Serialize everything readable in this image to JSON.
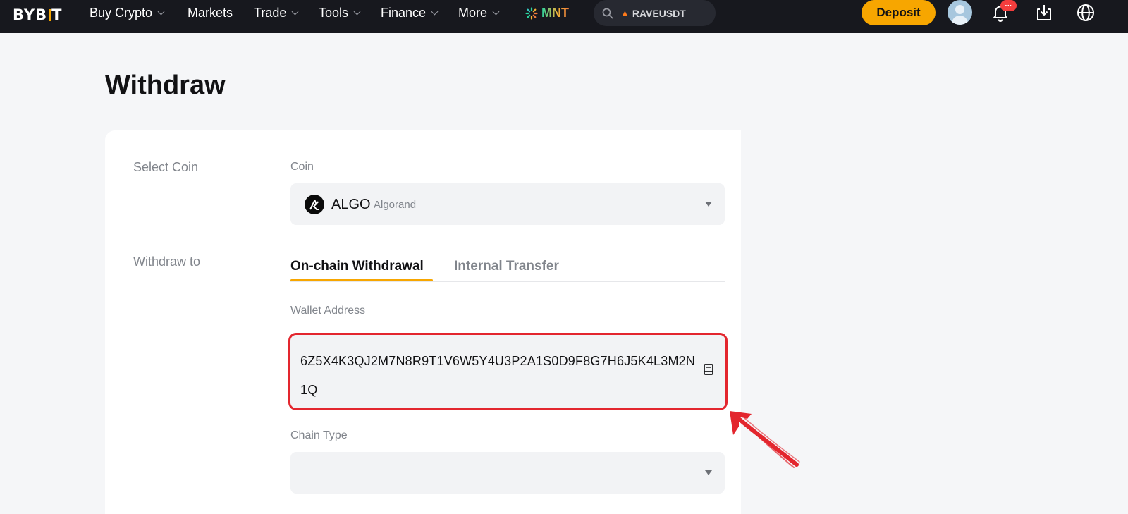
{
  "brand": {
    "logo_left": "BYB",
    "logo_right": "T"
  },
  "nav": {
    "items": [
      {
        "label": "Buy Crypto",
        "has_dropdown": true
      },
      {
        "label": "Markets",
        "has_dropdown": false
      },
      {
        "label": "Trade",
        "has_dropdown": true
      },
      {
        "label": "Tools",
        "has_dropdown": true
      },
      {
        "label": "Finance",
        "has_dropdown": true
      },
      {
        "label": "More",
        "has_dropdown": true
      }
    ],
    "promo": "MNT",
    "search": {
      "icon": "search-icon",
      "trending_icon": "flame-icon",
      "value": "RAVEUSDT"
    },
    "deposit_label": "Deposit",
    "notifications_badge": "···",
    "icons": [
      "avatar",
      "bell-icon",
      "download-icon",
      "globe-icon"
    ]
  },
  "page": {
    "title": "Withdraw",
    "select_coin": {
      "row_label": "Select Coin",
      "field_label": "Coin",
      "coin_symbol": "ALGO",
      "coin_name": "Algorand"
    },
    "withdraw_to": {
      "row_label": "Withdraw to",
      "tabs": [
        {
          "label": "On-chain Withdrawal",
          "active": true
        },
        {
          "label": "Internal Transfer",
          "active": false
        }
      ],
      "wallet_address_label": "Wallet Address",
      "wallet_address_value": "6Z5X4K3QJ2M7N8R9T1V6W5Y4U3P2A1S0D9F8G7H6J5K4L3M2N1Q",
      "chain_type_label": "Chain Type",
      "chain_type_value": ""
    }
  },
  "colors": {
    "accent": "#f7a600",
    "highlight": "#e3262e",
    "topbar": "#17181e"
  }
}
